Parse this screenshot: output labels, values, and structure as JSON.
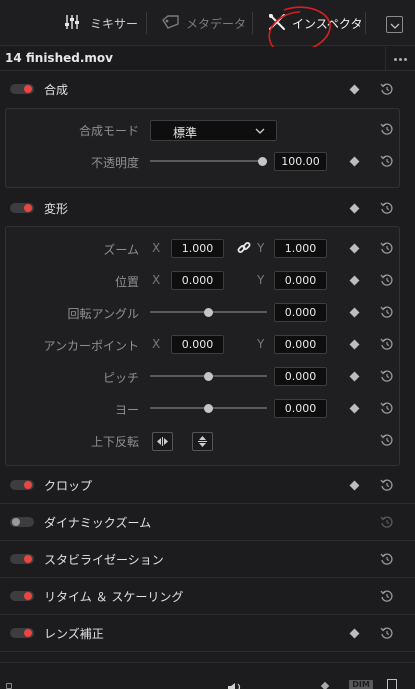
{
  "toolbar": {
    "mixer_label": "ミキサー",
    "metadata_label": "メタデータ",
    "inspector_label": "インスペクタ"
  },
  "clip": {
    "title": "14 finished.mov"
  },
  "sections": {
    "composite": "合成",
    "transform": "変形",
    "crop": "クロップ",
    "dynamic_zoom": "ダイナミックズーム",
    "stabilization": "スタビライゼーション",
    "retime": "リタイム ＆ スケーリング",
    "lens": "レンズ補正"
  },
  "composite": {
    "mode_label": "合成モード",
    "mode_value": "標準",
    "opacity_label": "不透明度",
    "opacity_value": "100.00",
    "opacity_level": 1.0
  },
  "transform": {
    "zoom_label": "ズーム",
    "zoom_x": "1.000",
    "zoom_y": "1.000",
    "position_label": "位置",
    "position_x": "0.000",
    "position_y": "0.000",
    "rotation_label": "回転アングル",
    "rotation_value": "0.000",
    "anchor_label": "アンカーポイント",
    "anchor_x": "0.000",
    "anchor_y": "0.000",
    "pitch_label": "ピッチ",
    "pitch_value": "0.000",
    "yaw_label": "ヨー",
    "yaw_value": "0.000",
    "flip_label": "上下反転",
    "axis_x": "X",
    "axis_y": "Y"
  },
  "bottom": {
    "badge": "DIM"
  }
}
